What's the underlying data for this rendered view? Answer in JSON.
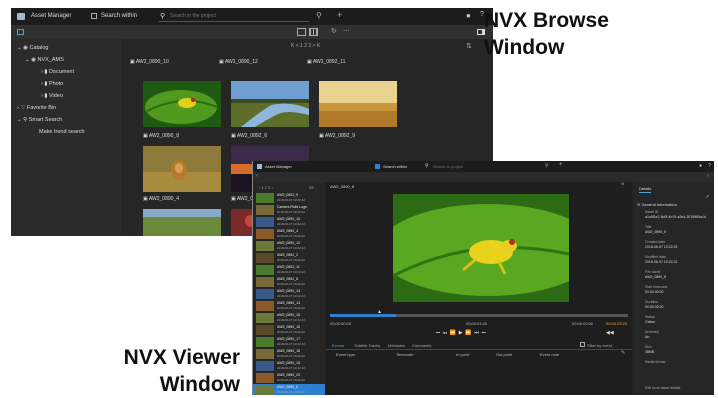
{
  "callouts": {
    "browse_line1": "NVX Browse",
    "browse_line2": "Window",
    "viewer_line1": "NVX Viewer",
    "viewer_line2": "Window"
  },
  "browse": {
    "app_title": "Asset Manager",
    "search_within": "Search within",
    "search_placeholder": "Search in the project",
    "pager": "K < 1 2 3 > K",
    "tree": {
      "catalog": "Catalog",
      "project": "NVX_AMS",
      "document": "Document",
      "photo": "Photo",
      "video": "Video",
      "favorite": "Favorite Bin",
      "smart_search": "Smart Search",
      "smart_item": "Make trend search"
    },
    "clips": [
      "AW2_0890_10",
      "AW2_0890_12",
      "AW2_0892_11",
      "AW2_0890_8",
      "AW2_0892_6",
      "AW2_0892_9",
      "AW2_0890_4",
      "AW2_0892_2"
    ]
  },
  "viewer": {
    "app_title": "Asset Manager",
    "search_within": "Search within",
    "search_placeholder": "Search in project",
    "clip_name": "AW2_0890_8",
    "count": "28",
    "times": [
      "00:00:00:00",
      "00:00:01:00",
      "00:00:02:00",
      "00:00:03:20"
    ],
    "tabs": [
      "Events",
      "Subtitle Tracks",
      "Metadata",
      "Comments"
    ],
    "headers": [
      "Event type",
      "Timecode",
      "In point",
      "Out point",
      "Event note"
    ],
    "filter": "Filter by event",
    "panel_title": "Details",
    "panel_section": "General Information",
    "panel_fields": [
      {
        "k": "Asset ID",
        "v": "a1c6f2a7-8d0f-4b79-a2b4-2015985a1d"
      },
      {
        "k": "Title",
        "v": "AW2_0890_8"
      },
      {
        "k": "Created date",
        "v": "2018-06-07 10:22:22"
      },
      {
        "k": "Modified date",
        "v": "2018-06-07 10:22:22"
      },
      {
        "k": "File name",
        "v": "AW2_0890_8"
      },
      {
        "k": "Start timecode",
        "v": "00:00:00:00"
      },
      {
        "k": "Duration",
        "v": "00:00:03:20"
      },
      {
        "k": "Status",
        "v": "Online"
      },
      {
        "k": "Archived",
        "v": "No"
      },
      {
        "k": "Size",
        "v": "38MB"
      },
      {
        "k": "Media format",
        "v": ""
      }
    ],
    "panel_footer": "Edit more asset details",
    "list": [
      {
        "n": "AW2_0892_9",
        "d": "2018-06-07 10:22:22"
      },
      {
        "n": "Camera Rolls Logs",
        "d": "2018-06-07 10:22:22"
      },
      {
        "n": "AW2_0890_10",
        "d": "2018-06-07 10:22:22"
      },
      {
        "n": "AW2_0890_4",
        "d": "2018-06-07 10:22:22"
      },
      {
        "n": "AW2_0890_12",
        "d": "2018-06-07 10:22:22"
      },
      {
        "n": "AW2_0892_2",
        "d": "2018-06-07 10:22:22"
      },
      {
        "n": "AW2_0892_11",
        "d": "2018-06-07 10:22:22"
      },
      {
        "n": "AW2_0892_6",
        "d": "2018-06-07 10:22:22"
      },
      {
        "n": "AW2_0890_13",
        "d": "2018-06-07 10:22:22"
      },
      {
        "n": "AW2_0890_14",
        "d": "2018-06-07 10:22:22"
      },
      {
        "n": "AW2_0890_15",
        "d": "2018-06-07 10:22:22"
      },
      {
        "n": "AW2_0890_16",
        "d": "2018-06-07 10:22:22"
      },
      {
        "n": "AW2_0890_17",
        "d": "2018-06-07 10:22:22"
      },
      {
        "n": "AW2_0890_18",
        "d": "2018-06-07 10:22:22"
      },
      {
        "n": "AW2_0890_19",
        "d": "2018-06-07 10:22:22"
      },
      {
        "n": "AW2_0890_20",
        "d": "2018-06-07 10:22:22"
      },
      {
        "n": "AW2_0890_8",
        "d": "2018-06-07 10:22:22"
      }
    ]
  }
}
